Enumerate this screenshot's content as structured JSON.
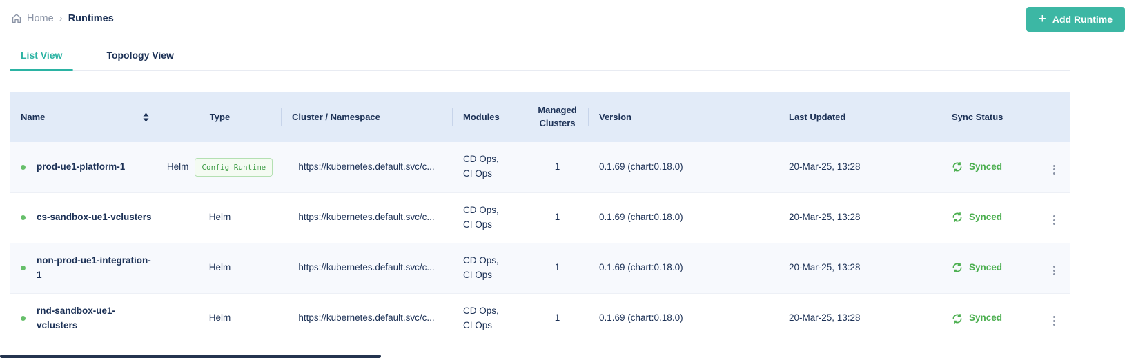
{
  "breadcrumb": {
    "home_label": "Home",
    "separator": "›",
    "current": "Runtimes"
  },
  "toolbar": {
    "add_runtime_label": "Add Runtime",
    "plus_icon": "+"
  },
  "tabs": {
    "list_view": "List View",
    "topology_view": "Topology View"
  },
  "table": {
    "columns": {
      "name": "Name",
      "type": "Type",
      "cluster": "Cluster / Namespace",
      "modules": "Modules",
      "managed_clusters": "Managed Clusters",
      "version": "Version",
      "last_updated": "Last Updated",
      "sync_status": "Sync Status"
    },
    "rows": [
      {
        "name": "prod-ue1-platform-1",
        "type": "Helm",
        "badge": "Config Runtime",
        "cluster": "https://kubernetes.default.svc/c...",
        "modules_line1": "CD Ops,",
        "modules_line2": "CI Ops",
        "managed_clusters": "1",
        "version": "0.1.69 (chart:0.18.0)",
        "last_updated": "20-Mar-25, 13:28",
        "sync_status": "Synced"
      },
      {
        "name": "cs-sandbox-ue1-vclusters",
        "type": "Helm",
        "cluster": "https://kubernetes.default.svc/c...",
        "modules_line1": "CD Ops,",
        "modules_line2": "CI Ops",
        "managed_clusters": "1",
        "version": "0.1.69 (chart:0.18.0)",
        "last_updated": "20-Mar-25, 13:28",
        "sync_status": "Synced"
      },
      {
        "name": "non-prod-ue1-integration-1",
        "type": "Helm",
        "cluster": "https://kubernetes.default.svc/c...",
        "modules_line1": "CD Ops,",
        "modules_line2": "CI Ops",
        "managed_clusters": "1",
        "version": "0.1.69 (chart:0.18.0)",
        "last_updated": "20-Mar-25, 13:28",
        "sync_status": "Synced"
      },
      {
        "name": "rnd-sandbox-ue1-vclusters",
        "type": "Helm",
        "cluster": "https://kubernetes.default.svc/c...",
        "modules_line1": "CD Ops,",
        "modules_line2": "CI Ops",
        "managed_clusters": "1",
        "version": "0.1.69 (chart:0.18.0)",
        "last_updated": "20-Mar-25, 13:28",
        "sync_status": "Synced"
      }
    ]
  },
  "colors": {
    "accent_teal": "#3cb7a4",
    "active_tab_teal": "#2bb3a3",
    "status_green": "#4caf50",
    "dot_green": "#66bf6a",
    "badge_green": "#3f9c46",
    "header_bg": "#e2ebf8",
    "text_navy": "#1c3156",
    "muted_gray": "#8a93a5"
  }
}
